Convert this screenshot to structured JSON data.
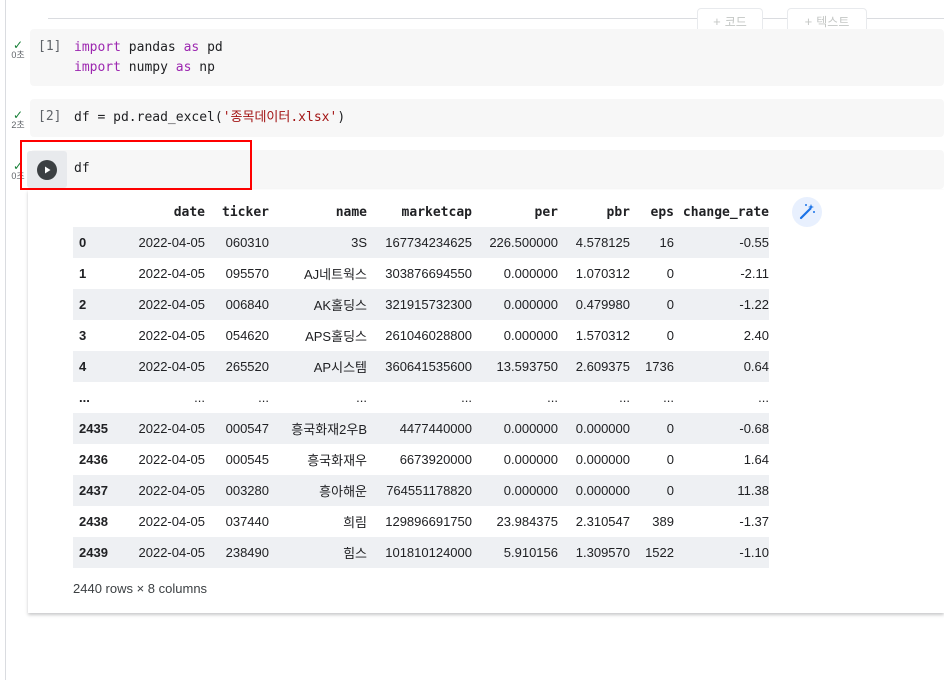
{
  "toolbar": {
    "add_code": "코드",
    "add_text": "텍스트"
  },
  "cells": [
    {
      "exec": "[1]",
      "time": "0초",
      "lines": [
        [
          {
            "t": "import",
            "k": "kw"
          },
          {
            "t": " pandas "
          },
          {
            "t": "as",
            "k": "kw"
          },
          {
            "t": " pd"
          }
        ],
        [
          {
            "t": "import",
            "k": "kw"
          },
          {
            "t": " numpy "
          },
          {
            "t": "as",
            "k": "kw"
          },
          {
            "t": " np"
          }
        ]
      ]
    },
    {
      "exec": "[2]",
      "time": "2초",
      "lines": [
        [
          {
            "t": "df = pd.read_excel("
          },
          {
            "t": "'종목데이터.xlsx'",
            "k": "str"
          },
          {
            "t": ")"
          }
        ]
      ]
    },
    {
      "exec": "",
      "time": "0초",
      "lines": [
        [
          {
            "t": "df"
          }
        ]
      ]
    }
  ],
  "output": {
    "columns": [
      "",
      "date",
      "ticker",
      "name",
      "marketcap",
      "per",
      "pbr",
      "eps",
      "change_rate"
    ],
    "rows": [
      [
        "0",
        "2022-04-05",
        "060310",
        "3S",
        "167734234625",
        "226.500000",
        "4.578125",
        "16",
        "-0.55"
      ],
      [
        "1",
        "2022-04-05",
        "095570",
        "AJ네트웍스",
        "303876694550",
        "0.000000",
        "1.070312",
        "0",
        "-2.11"
      ],
      [
        "2",
        "2022-04-05",
        "006840",
        "AK홀딩스",
        "321915732300",
        "0.000000",
        "0.479980",
        "0",
        "-1.22"
      ],
      [
        "3",
        "2022-04-05",
        "054620",
        "APS홀딩스",
        "261046028800",
        "0.000000",
        "1.570312",
        "0",
        "2.40"
      ],
      [
        "4",
        "2022-04-05",
        "265520",
        "AP시스템",
        "360641535600",
        "13.593750",
        "2.609375",
        "1736",
        "0.64"
      ],
      [
        "...",
        "...",
        "...",
        "...",
        "...",
        "...",
        "...",
        "...",
        "..."
      ],
      [
        "2435",
        "2022-04-05",
        "000547",
        "흥국화재2우B",
        "4477440000",
        "0.000000",
        "0.000000",
        "0",
        "-0.68"
      ],
      [
        "2436",
        "2022-04-05",
        "000545",
        "흥국화재우",
        "6673920000",
        "0.000000",
        "0.000000",
        "0",
        "1.64"
      ],
      [
        "2437",
        "2022-04-05",
        "003280",
        "흥아해운",
        "764551178820",
        "0.000000",
        "0.000000",
        "0",
        "11.38"
      ],
      [
        "2438",
        "2022-04-05",
        "037440",
        "희림",
        "129896691750",
        "23.984375",
        "2.310547",
        "389",
        "-1.37"
      ],
      [
        "2439",
        "2022-04-05",
        "238490",
        "힘스",
        "101810124000",
        "5.910156",
        "1.309570",
        "1522",
        "-1.10"
      ]
    ],
    "footer": "2440 rows × 8 columns"
  },
  "colors": {
    "accent_check": "#188038",
    "highlight_box": "#ff0000",
    "keyword": "#9c27b0",
    "string": "#a31515"
  }
}
